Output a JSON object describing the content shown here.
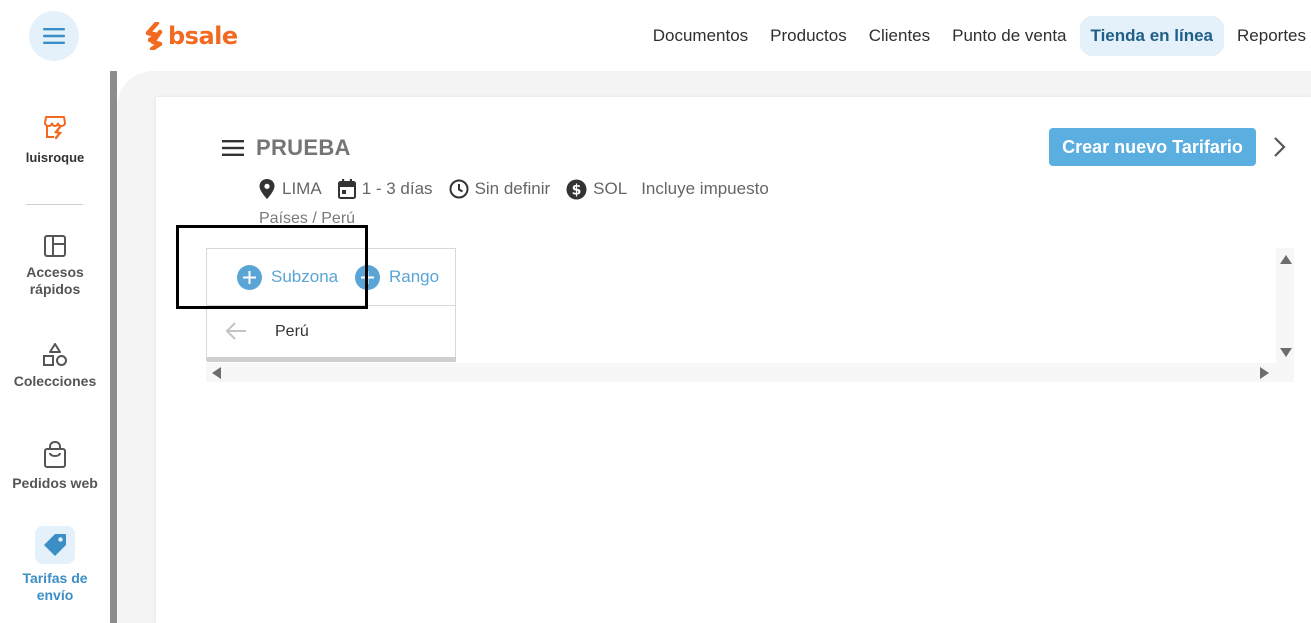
{
  "brand": {
    "name": "bsale",
    "color": "#f26a21"
  },
  "topnav": {
    "items": [
      {
        "label": "Documentos",
        "active": false
      },
      {
        "label": "Productos",
        "active": false
      },
      {
        "label": "Clientes",
        "active": false
      },
      {
        "label": "Punto de venta",
        "active": false
      },
      {
        "label": "Tienda en línea",
        "active": true
      },
      {
        "label": "Reportes",
        "active": false
      }
    ]
  },
  "sidebar": {
    "user": {
      "label": "luisroque",
      "icon": "store-icon"
    },
    "items": [
      {
        "label": "Accesos rápidos",
        "icon": "layout-icon",
        "active": false
      },
      {
        "label": "Colecciones",
        "icon": "shapes-icon",
        "active": false
      },
      {
        "label": "Pedidos web",
        "icon": "shopping-bag-icon",
        "active": false
      },
      {
        "label": "Tarifas de envío",
        "icon": "tag-icon",
        "active": true
      }
    ]
  },
  "main": {
    "title": "PRUEBA",
    "create_button": "Crear nuevo Tarifario",
    "meta": {
      "location": "LIMA",
      "delivery": "1 - 3 días",
      "time": "Sin definir",
      "currency": "SOL",
      "tax": "Incluye impuesto"
    },
    "breadcrumb": "Países / Perú",
    "table": {
      "actions": {
        "subzona": "Subzona",
        "rango": "Rango"
      },
      "row": {
        "label": "Perú"
      }
    }
  },
  "colors": {
    "accent": "#5aaee0",
    "active_bg": "#e4f1fa",
    "active_text": "#1f5f87"
  }
}
